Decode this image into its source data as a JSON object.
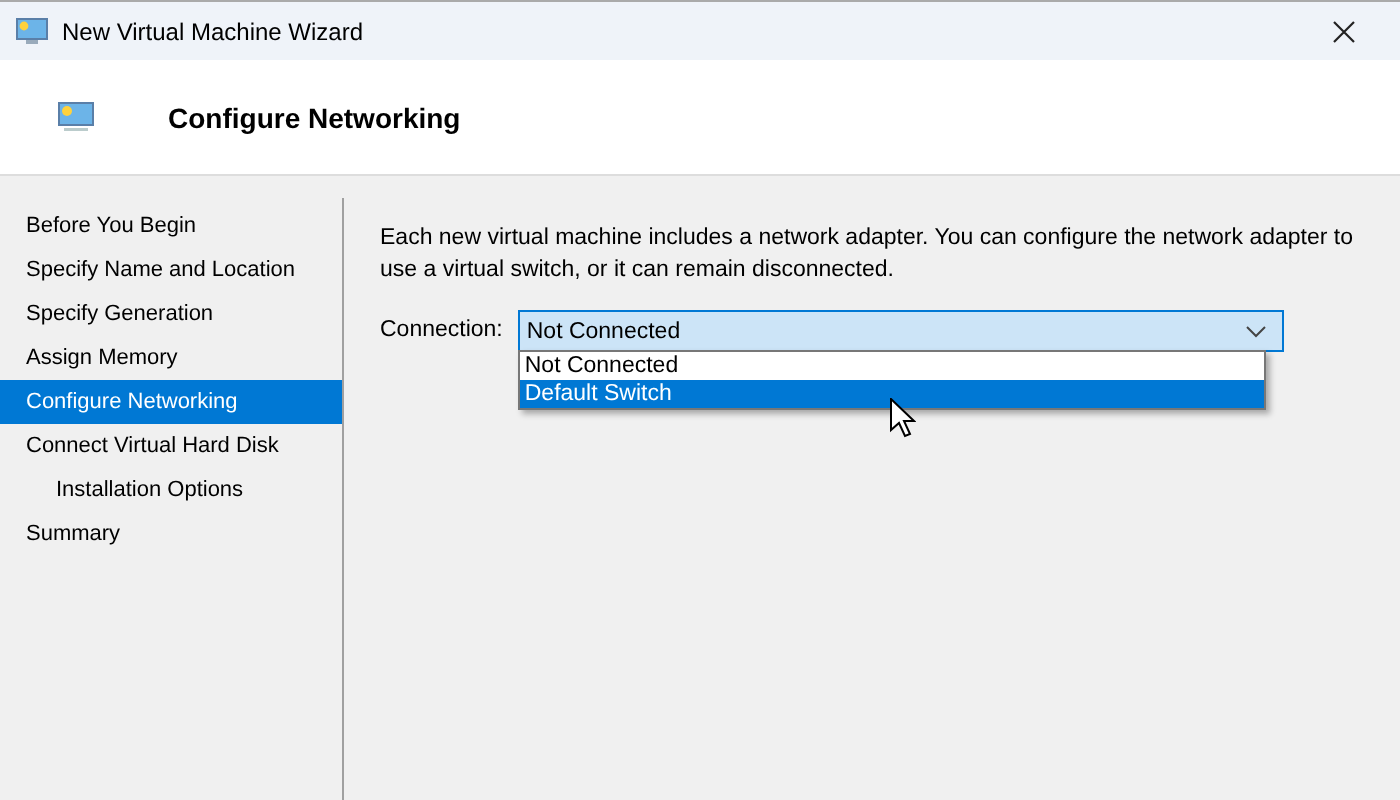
{
  "window": {
    "title": "New Virtual Machine Wizard"
  },
  "header": {
    "title": "Configure Networking"
  },
  "steps": [
    {
      "label": "Before You Begin",
      "selected": false
    },
    {
      "label": "Specify Name and Location",
      "selected": false
    },
    {
      "label": "Specify Generation",
      "selected": false
    },
    {
      "label": "Assign Memory",
      "selected": false
    },
    {
      "label": "Configure Networking",
      "selected": true
    },
    {
      "label": "Connect Virtual Hard Disk",
      "selected": false,
      "children": [
        {
          "label": "Installation Options",
          "selected": false
        }
      ]
    },
    {
      "label": "Summary",
      "selected": false
    }
  ],
  "description": "Each new virtual machine includes a network adapter. You can configure the network adapter to use a virtual switch, or it can remain disconnected.",
  "connection": {
    "label": "Connection:",
    "value": "Not Connected",
    "expanded": true,
    "options": [
      {
        "label": "Not Connected",
        "highlighted": false
      },
      {
        "label": "Default Switch",
        "highlighted": true
      }
    ]
  }
}
